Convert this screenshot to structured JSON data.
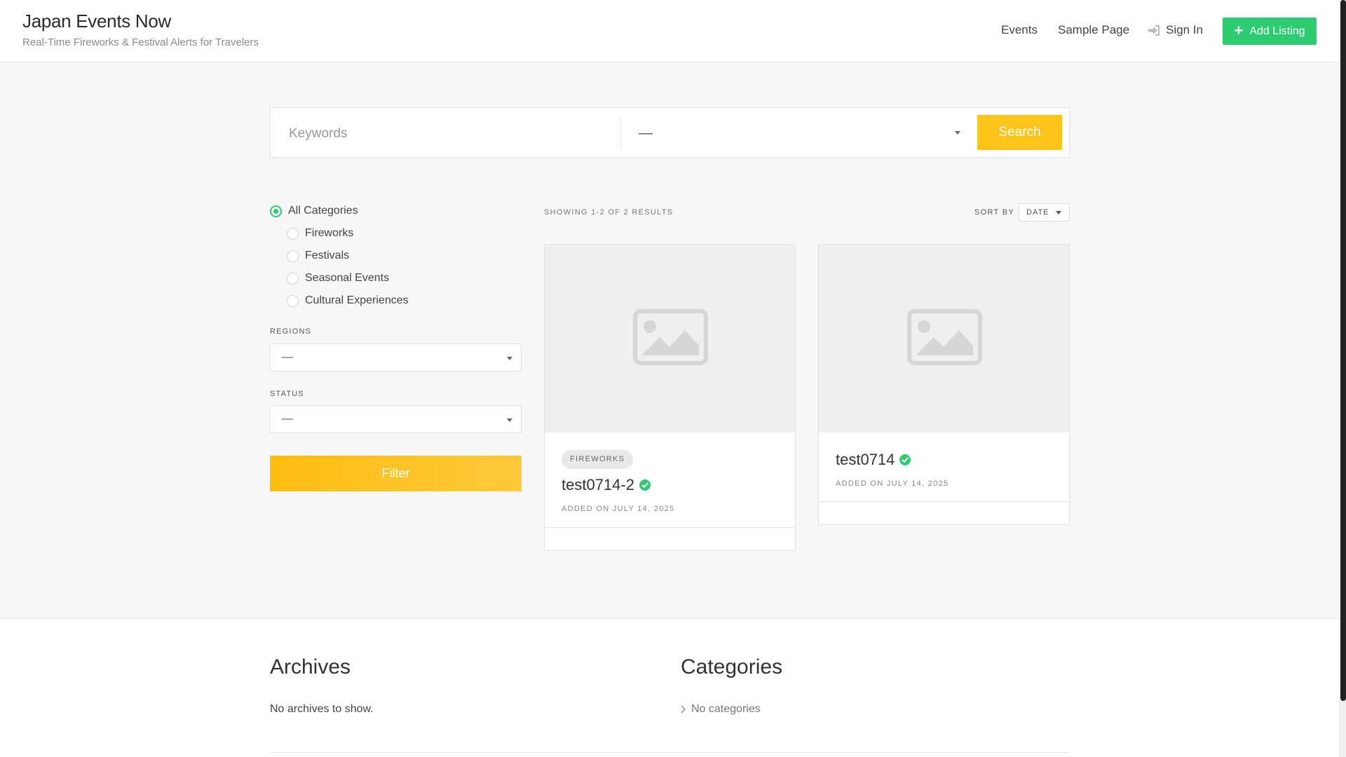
{
  "header": {
    "title": "Japan Events Now",
    "tagline": "Real-Time Fireworks & Festival Alerts for Travelers",
    "nav": {
      "events": "Events",
      "sample_page": "Sample Page",
      "sign_in": "Sign In"
    },
    "add_listing": "Add Listing",
    "accent_color": "#2ecc71"
  },
  "search": {
    "keywords_placeholder": "Keywords",
    "location_value": "—",
    "search_label": "Search",
    "button_color": "#fec41a"
  },
  "filters": {
    "categories": [
      {
        "label": "All Categories",
        "selected": true
      },
      {
        "label": "Fireworks",
        "selected": false
      },
      {
        "label": "Festivals",
        "selected": false
      },
      {
        "label": "Seasonal Events",
        "selected": false
      },
      {
        "label": "Cultural Experiences",
        "selected": false
      }
    ],
    "regions_label": "REGIONS",
    "regions_value": "—",
    "status_label": "STATUS",
    "status_value": "—",
    "filter_label": "Filter"
  },
  "results": {
    "summary": "SHOWING 1-2 OF 2 RESULTS",
    "sort_label": "SORT BY",
    "sort_value": "DATE",
    "listings": [
      {
        "tag": "FIREWORKS",
        "title": "test0714-2",
        "verified": true,
        "date": "ADDED ON JULY 14, 2025"
      },
      {
        "tag": "",
        "title": "test0714",
        "verified": true,
        "date": "ADDED ON JULY 14, 2025"
      }
    ]
  },
  "footer": {
    "archives_title": "Archives",
    "archives_text": "No archives to show.",
    "categories_title": "Categories",
    "categories_text": "No categories"
  }
}
